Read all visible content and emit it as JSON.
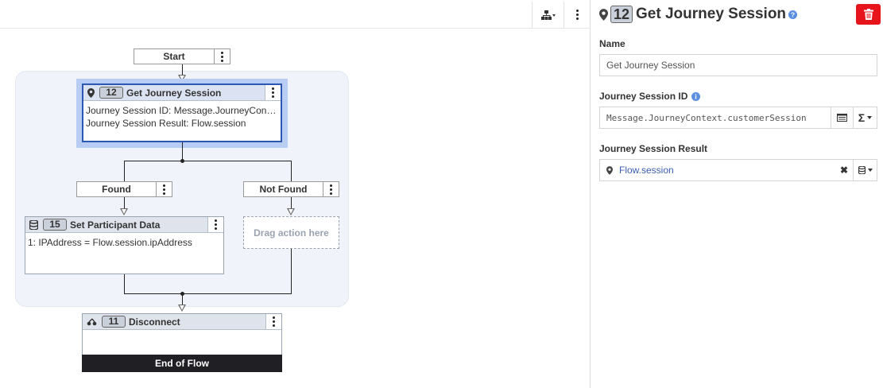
{
  "toolbar": {
    "tree_icon": "hierarchy-icon",
    "more_icon": "kebab-icon"
  },
  "flow": {
    "start_label": "Start",
    "get_session_node": {
      "icon": "location-pin-icon",
      "number": "12",
      "title": "Get Journey Session",
      "lines": [
        "Journey Session ID: Message.JourneyContext.customerSession",
        "Journey Session Result: Flow.session"
      ]
    },
    "found_label": "Found",
    "not_found_label": "Not Found",
    "set_participant_node": {
      "icon": "database-icon",
      "number": "15",
      "title": "Set Participant Data",
      "lines": [
        "1: IPAddress = Flow.session.ipAddress"
      ]
    },
    "drag_placeholder": "Drag action here",
    "disconnect_node": {
      "icon": "disconnect-icon",
      "number": "11",
      "title": "Disconnect",
      "footer": "End of Flow"
    }
  },
  "panel": {
    "number": "12",
    "title": "Get Journey Session",
    "name_label": "Name",
    "name_value": "Get Journey Session",
    "journey_id_label": "Journey Session ID",
    "journey_id_value": "Message.JourneyContext.customerSession",
    "journey_result_label": "Journey Session Result",
    "journey_result_value": "Flow.session"
  },
  "colors": {
    "accent": "#2b58b2",
    "delete": "#e8141c",
    "link": "#3a5fb0",
    "info": "#5b8fe0"
  }
}
